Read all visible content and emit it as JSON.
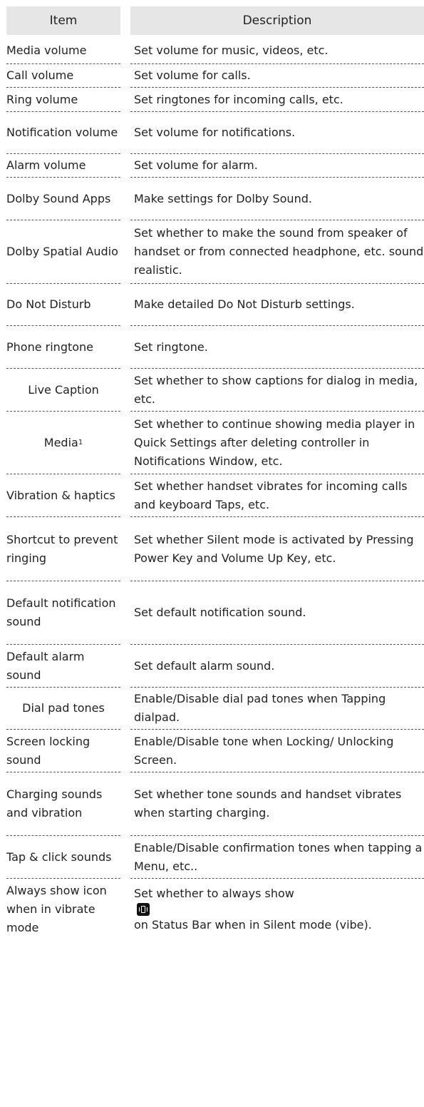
{
  "header": {
    "item": "Item",
    "description": "Description"
  },
  "rows": [
    {
      "item": "Media volume",
      "desc": "Set volume for music, videos, etc."
    },
    {
      "item": "Call volume",
      "desc": "Set volume for calls."
    },
    {
      "item": "Ring volume",
      "desc": "Set ringtones for incoming calls, etc."
    },
    {
      "item": "Notification volume",
      "desc": "Set volume for notifications."
    },
    {
      "item": "Alarm volume",
      "desc": "Set volume for alarm."
    },
    {
      "item": "Dolby Sound Apps",
      "desc": "Make settings for Dolby Sound."
    },
    {
      "item": "Dolby Spatial Audio",
      "desc": "Set whether to make the sound from speaker of handset or from connected headphone, etc. sound realistic."
    },
    {
      "item": "Do Not Disturb",
      "desc": "Make detailed Do Not Disturb settings."
    },
    {
      "item": "Phone ringtone",
      "desc": "Set ringtone."
    },
    {
      "item": "Live Caption",
      "desc": "Set whether to show captions for dialog in media, etc."
    },
    {
      "item": "Media",
      "item_sup": "1",
      "desc": "Set whether to continue showing media player in Quick Settings after deleting controller in Notifications Window, etc."
    },
    {
      "item": "Vibration & haptics",
      "desc": "Set whether handset vibrates for incoming calls and keyboard Taps, etc."
    },
    {
      "item": "Shortcut to prevent ringing",
      "desc": "Set whether Silent mode is activated by Pressing Power Key and Volume Up Key, etc."
    },
    {
      "item": "Default notification sound",
      "desc": "Set default notification sound."
    },
    {
      "item": "Default alarm sound",
      "desc": "Set default alarm sound."
    },
    {
      "item": "Dial pad tones",
      "desc": "Enable/Disable dial pad tones when Tapping dialpad."
    },
    {
      "item": "Screen locking sound",
      "desc": "Enable/Disable tone when Locking/ Unlocking Screen."
    },
    {
      "item": "Charging sounds and vibration",
      "desc": "Set whether tone sounds and handset vibrates when starting charging."
    },
    {
      "item": "Tap & click sounds",
      "desc": "Enable/Disable confirmation tones when tapping a Menu, etc.."
    },
    {
      "item": "Always show icon when in vibrate mode",
      "desc_before": "Set whether to always show",
      "desc_icon": "vibrate-icon",
      "desc_after": "on Status Bar when in Silent mode (vibe)."
    }
  ]
}
